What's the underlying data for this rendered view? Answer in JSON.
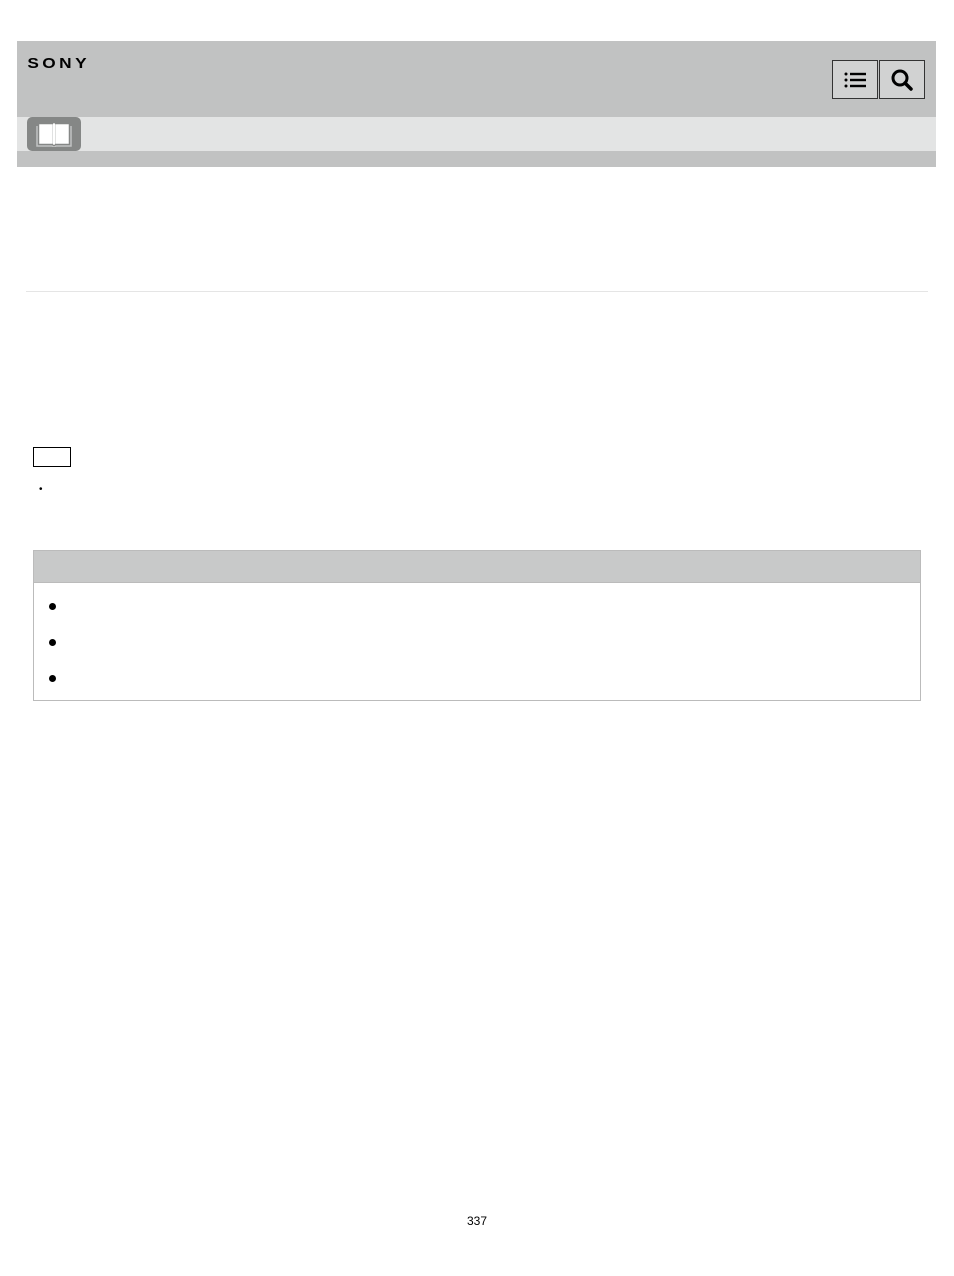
{
  "header": {
    "brand": "SONY"
  },
  "page_number": "337",
  "bullets": [
    "",
    "",
    ""
  ]
}
